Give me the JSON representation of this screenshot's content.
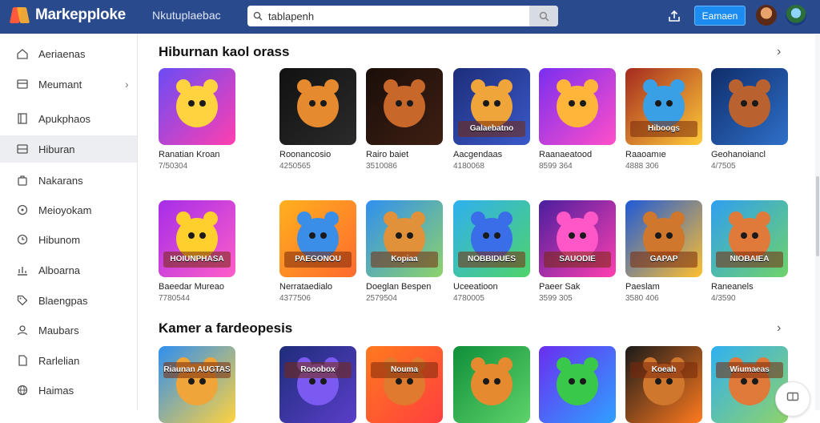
{
  "app": {
    "name": "Markepploke",
    "nav": "Nkutuplaebac"
  },
  "search": {
    "value": "tablapenh",
    "placeholder": ""
  },
  "header": {
    "primary_button": "Eamaen"
  },
  "sidebar": {
    "items": [
      {
        "label": "Aeriaenas",
        "icon": "home-icon",
        "chevron": false
      },
      {
        "label": "Meumant",
        "icon": "dashboard-icon",
        "chevron": true
      },
      {
        "label": "Apukphaos",
        "icon": "book-icon",
        "chevron": false
      },
      {
        "label": "Hiburan",
        "icon": "grid-icon",
        "chevron": false,
        "active": true
      },
      {
        "label": "Nakarans",
        "icon": "bag-icon",
        "chevron": false
      },
      {
        "label": "Meioyokam",
        "icon": "circle-icon",
        "chevron": false
      },
      {
        "label": "Hibunom",
        "icon": "clock-icon",
        "chevron": false
      },
      {
        "label": "Alboarna",
        "icon": "chart-icon",
        "chevron": false
      },
      {
        "label": "Blaengpas",
        "icon": "tag-icon",
        "chevron": false
      },
      {
        "label": "Maubars",
        "icon": "user-icon",
        "chevron": false
      },
      {
        "label": "Rarlelian",
        "icon": "file-icon",
        "chevron": false
      },
      {
        "label": "Haimas",
        "icon": "globe-icon",
        "chevron": false
      }
    ]
  },
  "sections": [
    {
      "title": "Hiburnan kaol orass",
      "cards": [
        {
          "title": "Ranatian Kroan",
          "meta": "7/50304",
          "colors": [
            "#6a4cf5",
            "#ff3fb0"
          ],
          "creature": "#ffd23f",
          "banner": ""
        },
        {
          "title": "Roonancosio",
          "meta": "4250565",
          "colors": [
            "#111111",
            "#2b2b2b"
          ],
          "creature": "#e58a2e",
          "banner": ""
        },
        {
          "title": "Rairo baiet",
          "meta": "3510086",
          "colors": [
            "#1a0e0a",
            "#3e1f12"
          ],
          "creature": "#c7672a",
          "banner": ""
        },
        {
          "title": "Aacgendaas",
          "meta": "4180068",
          "colors": [
            "#1d2d7a",
            "#3a59c9"
          ],
          "creature": "#f0a53a",
          "banner": "Galaebatno"
        },
        {
          "title": "Raanaeatood",
          "meta": "8599 364",
          "colors": [
            "#7a2ef0",
            "#ff4fc8"
          ],
          "creature": "#ffb43a",
          "banner": ""
        },
        {
          "title": "Raaoamıe",
          "meta": "4888 306",
          "colors": [
            "#a52a1e",
            "#ffcb3a"
          ],
          "creature": "#3aa0e6",
          "banner": "Hiboogs"
        },
        {
          "title": "Geohanoiancl",
          "meta": "4/7505",
          "colors": [
            "#0f2d6b",
            "#2f70c9"
          ],
          "creature": "#b9622f",
          "banner": ""
        }
      ]
    },
    {
      "title": "",
      "cards": [
        {
          "title": "Baeedar Mureao",
          "meta": "7780544",
          "colors": [
            "#a52de8",
            "#ff5ec8"
          ],
          "creature": "#ffcf2e",
          "banner": "HOIUNPHASA"
        },
        {
          "title": "Nerrataedialo",
          "meta": "4377506",
          "colors": [
            "#ffb01e",
            "#ff6a2e"
          ],
          "creature": "#3a8ee8",
          "banner": "PAEGONOU"
        },
        {
          "title": "Doeglan Bespen",
          "meta": "2579504",
          "colors": [
            "#2f8ff0",
            "#8fd36a"
          ],
          "creature": "#e0913a",
          "banner": "Kopiaa"
        },
        {
          "title": "Uceeatioon",
          "meta": "4780005",
          "colors": [
            "#2fb0f0",
            "#4fd36a"
          ],
          "creature": "#3a6ee8",
          "banner": "NOBBIDUES"
        },
        {
          "title": "Paeer Sak",
          "meta": "3599 305",
          "colors": [
            "#4a1e9e",
            "#ff3fb0"
          ],
          "creature": "#ff57c8",
          "banner": "SAUODIE"
        },
        {
          "title": "Paeslam",
          "meta": "3580 406",
          "colors": [
            "#1e5ad8",
            "#ffbf2e"
          ],
          "creature": "#d0772e",
          "banner": "GAPAP"
        },
        {
          "title": "Raneanels",
          "meta": "4/3590",
          "colors": [
            "#2f9ff0",
            "#6fd36a"
          ],
          "creature": "#e07a3a",
          "banner": "NIOBAIEA"
        }
      ]
    },
    {
      "title": "Kamer a fardeopesis",
      "cards": [
        {
          "title": "",
          "meta": "",
          "colors": [
            "#2f8ff0",
            "#ffd23f"
          ],
          "creature": "#f0a53a",
          "banner": "Riaunan AUGTAS"
        },
        {
          "title": "",
          "meta": "",
          "colors": [
            "#1e2d7a",
            "#5a3ec9"
          ],
          "creature": "#7a5af0",
          "banner": "Rooobox"
        },
        {
          "title": "",
          "meta": "",
          "colors": [
            "#ff7a1e",
            "#ff3f3f"
          ],
          "creature": "#e07a2e",
          "banner": "Nouma"
        },
        {
          "title": "",
          "meta": "",
          "colors": [
            "#0f8f3a",
            "#5fd36a"
          ],
          "creature": "#e58a2e",
          "banner": ""
        },
        {
          "title": "",
          "meta": "",
          "colors": [
            "#6a2ef0",
            "#2fa0ff"
          ],
          "creature": "#3ac84a",
          "banner": ""
        },
        {
          "title": "",
          "meta": "",
          "colors": [
            "#1a1a1a",
            "#ff7a1e"
          ],
          "creature": "#d0772e",
          "banner": "Koeah"
        },
        {
          "title": "",
          "meta": "",
          "colors": [
            "#2fb0f0",
            "#8fd36a"
          ],
          "creature": "#e07a3a",
          "banner": "Wiumaeas"
        }
      ]
    }
  ]
}
